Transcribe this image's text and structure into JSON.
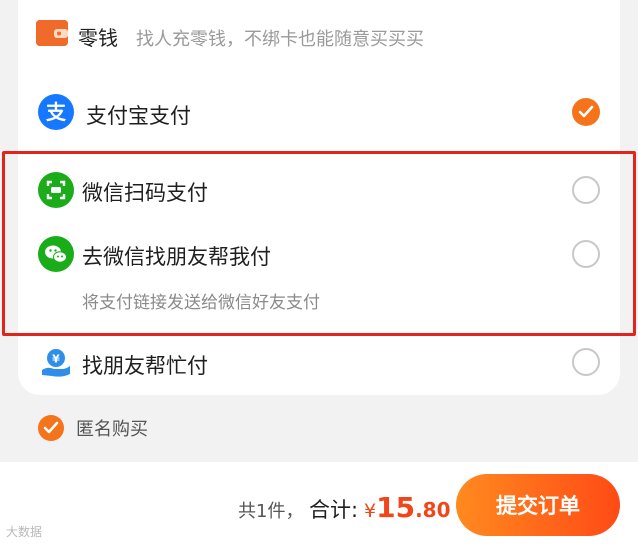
{
  "options": {
    "change": {
      "label": "零钱",
      "hint": "找人充零钱，不绑卡也能随意买买买"
    },
    "alipay": {
      "label": "支付宝支付",
      "selected": true
    },
    "wechat_scan": {
      "label": "微信扫码支付",
      "selected": false
    },
    "wechat_friend": {
      "label": "去微信找朋友帮我付",
      "description": "将支付链接发送给微信好友支付",
      "selected": false
    },
    "friend_help": {
      "label": "找朋友帮忙付",
      "selected": false
    }
  },
  "anonymous": {
    "label": "匿名购买",
    "checked": true
  },
  "footer": {
    "count_text": "共1件，",
    "total_label": "合计:",
    "currency": "¥",
    "price_int": "15",
    "price_dec": ".80",
    "submit_label": "提交订单"
  },
  "watermark": "大数据",
  "colors": {
    "accent": "#f5731b",
    "highlight": "#e3241c",
    "alipay": "#1677ff",
    "wechat": "#1aad19",
    "friend": "#2f8fe8"
  },
  "icons": {
    "change": "wallet-icon",
    "alipay": "alipay-icon",
    "wechat_scan": "wechat-scan-icon",
    "wechat_friend": "wechat-icon",
    "friend_help": "yuan-hand-icon"
  }
}
